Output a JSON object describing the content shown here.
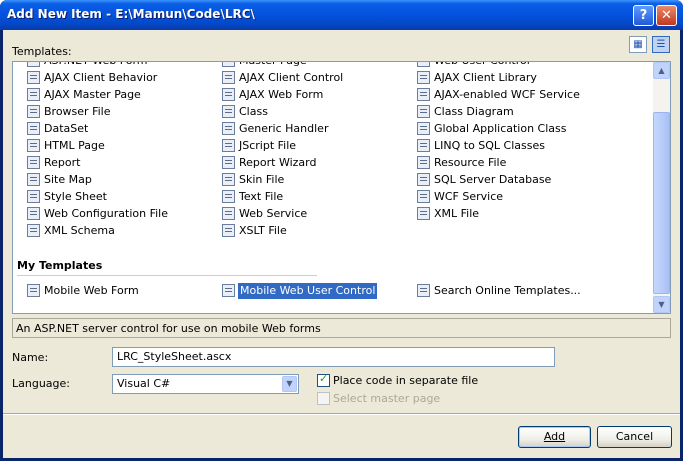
{
  "window": {
    "title": "Add New Item - E:\\Mamun\\Code\\LRC\\"
  },
  "templates_label": "Templates:",
  "view_buttons": [
    {
      "icon": "large-icons-view-icon"
    },
    {
      "icon": "small-icons-view-icon"
    }
  ],
  "partial_row": [
    "ASP.NET Web Form",
    "Master Page",
    "Web User Control"
  ],
  "installed_templates": [
    [
      "AJAX Client Behavior",
      "AJAX Client Control",
      "AJAX Client Library"
    ],
    [
      "AJAX Master Page",
      "AJAX Web Form",
      "AJAX-enabled WCF Service"
    ],
    [
      "Browser File",
      "Class",
      "Class Diagram"
    ],
    [
      "DataSet",
      "Generic Handler",
      "Global Application Class"
    ],
    [
      "HTML Page",
      "JScript File",
      "LINQ to SQL Classes"
    ],
    [
      "Report",
      "Report Wizard",
      "Resource File"
    ],
    [
      "Site Map",
      "Skin File",
      "SQL Server Database"
    ],
    [
      "Style Sheet",
      "Text File",
      "WCF Service"
    ],
    [
      "Web Configuration File",
      "Web Service",
      "XML File"
    ],
    [
      "XML Schema",
      "XSLT File",
      ""
    ]
  ],
  "my_templates_header": "My Templates",
  "my_templates": [
    "Mobile Web Form",
    "Mobile Web User Control",
    "Search Online Templates..."
  ],
  "selected_template": "Mobile Web User Control",
  "description": "An ASP.NET server control for use on mobile Web forms",
  "name_label": "Name:",
  "name_value": "LRC_StyleSheet.ascx",
  "language_label": "Language:",
  "language_value": "Visual C#",
  "place_code_label": "Place code in separate file",
  "place_code_checked": true,
  "select_master_label": "Select master page",
  "select_master_enabled": false,
  "add_button": "Add",
  "cancel_button": "Cancel"
}
